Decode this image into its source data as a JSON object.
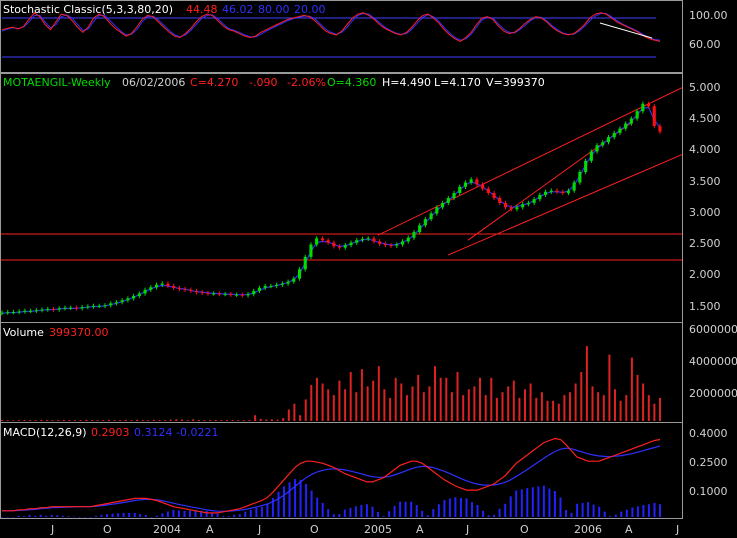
{
  "colors": {
    "background": "#000000",
    "axis_text": "#d0d0d0",
    "panel_border": "#9a9a9a",
    "candle_up": "#00dd00",
    "candle_down": "#ff1010",
    "trend_line": "#ff2020",
    "horizontal_line": "#ff2020",
    "ma_line": "#3030ff",
    "volume_bar": "#dd2222",
    "macd_line": "#ff2020",
    "signal_line": "#3030ff",
    "histogram": "#2222ff",
    "stoch_k": "#ff2020",
    "stoch_d": "#3030ff",
    "stoch_level": "#4040ff",
    "annotation_line": "#ffffff",
    "price_title": "#00dd00",
    "stoch_title": "#ffffff"
  },
  "stochastic": {
    "name": "Stochastic Classic(5,3,3,80,20)",
    "k_text": "44.48",
    "d_text": "46.02",
    "upper_text": "80.00",
    "lower_text": "20.00",
    "axis_ticks": [
      "100.00",
      "60.00"
    ]
  },
  "price": {
    "symbol": "MOTAENGIL-Weekly",
    "date": "06/02/2006",
    "close": "C=4.270",
    "change": "-.090",
    "change_pct": "-2.06%",
    "open": "O=4.360",
    "high": "H=4.490",
    "low": "L=4.170",
    "volume": "V=399370",
    "axis_ticks": [
      "5.000",
      "4.500",
      "4.000",
      "3.500",
      "3.000",
      "2.500",
      "2.000",
      "1.500"
    ]
  },
  "volume": {
    "label": "Volume",
    "value_text": "399370.00",
    "axis_ticks": [
      "6000000",
      "4000000",
      "2000000"
    ]
  },
  "macd": {
    "label": "MACD(12,26,9)",
    "macd_text": "0.2903",
    "signal_text": "0.3124",
    "hist_text": "-0.0221",
    "axis_ticks": [
      "0.4000",
      "0.2500",
      "0.1000"
    ]
  },
  "x_axis": {
    "labels": [
      "J",
      "O",
      "2004",
      "A",
      "J",
      "O",
      "2005",
      "A",
      "J",
      "O",
      "2006",
      "A",
      "J"
    ]
  },
  "chart_data": [
    {
      "type": "line",
      "title": "Stochastic Classic(5,3,3,80,20)",
      "ylim": [
        0,
        100
      ],
      "levels": [
        80,
        20
      ],
      "series": [
        {
          "values": [
            62,
            64,
            66,
            63,
            67,
            78,
            88,
            82,
            70,
            62,
            74,
            86,
            84,
            76,
            66,
            58,
            66,
            80,
            86,
            82,
            72,
            64,
            58,
            52,
            56,
            66,
            78,
            84,
            82,
            74,
            66,
            58,
            52,
            50,
            56,
            64,
            74,
            82,
            86,
            84,
            76,
            68,
            62,
            60,
            56,
            52,
            50,
            52,
            58,
            62,
            66,
            70,
            74,
            78,
            80,
            82,
            84,
            82,
            76,
            68,
            60,
            56,
            54,
            60,
            70,
            80,
            86,
            88,
            84,
            78,
            70,
            64,
            60,
            56,
            54,
            58,
            66,
            76,
            84,
            86,
            80,
            72,
            62,
            54,
            48,
            44,
            50,
            58,
            70,
            80,
            82,
            78,
            68,
            60,
            56,
            58,
            64,
            72,
            78,
            82,
            80,
            74,
            66,
            60,
            56,
            54,
            56,
            62,
            70,
            80,
            86,
            88,
            86,
            80,
            74,
            70,
            66,
            62,
            58,
            52,
            48,
            46,
            44
          ]
        },
        {
          "values": [
            60,
            63,
            65,
            64,
            66,
            74,
            84,
            84,
            74,
            65,
            70,
            82,
            85,
            80,
            70,
            61,
            63,
            75,
            84,
            84,
            76,
            68,
            60,
            54,
            55,
            62,
            74,
            82,
            83,
            77,
            69,
            61,
            54,
            51,
            54,
            61,
            70,
            79,
            84,
            85,
            79,
            71,
            64,
            61,
            58,
            54,
            51,
            51,
            55,
            60,
            64,
            68,
            72,
            76,
            79,
            81,
            83,
            83,
            79,
            71,
            63,
            58,
            55,
            58,
            66,
            76,
            84,
            87,
            86,
            80,
            73,
            66,
            61,
            57,
            55,
            56,
            63,
            72,
            81,
            85,
            82,
            75,
            65,
            57,
            50,
            46,
            48,
            55,
            66,
            77,
            81,
            80,
            71,
            63,
            58,
            57,
            62,
            69,
            76,
            81,
            81,
            76,
            68,
            62,
            57,
            55,
            55,
            60,
            67,
            76,
            83,
            87,
            87,
            82,
            76,
            71,
            67,
            63,
            59,
            54,
            50,
            47,
            46
          ]
        }
      ]
    },
    {
      "type": "candlestick",
      "title": "MOTAENGIL-Weekly",
      "ylim": [
        1.2,
        5.2
      ],
      "horizontal_lines": [
        2.62,
        2.2
      ],
      "close_values": [
        1.35,
        1.36,
        1.36,
        1.37,
        1.38,
        1.38,
        1.39,
        1.4,
        1.41,
        1.4,
        1.42,
        1.43,
        1.43,
        1.42,
        1.44,
        1.45,
        1.46,
        1.46,
        1.47,
        1.5,
        1.52,
        1.55,
        1.58,
        1.62,
        1.66,
        1.72,
        1.76,
        1.8,
        1.82,
        1.78,
        1.75,
        1.73,
        1.72,
        1.7,
        1.68,
        1.67,
        1.66,
        1.66,
        1.65,
        1.65,
        1.64,
        1.64,
        1.63,
        1.65,
        1.7,
        1.75,
        1.78,
        1.78,
        1.8,
        1.82,
        1.85,
        1.9,
        2.05,
        2.25,
        2.45,
        2.55,
        2.52,
        2.48,
        2.42,
        2.4,
        2.44,
        2.48,
        2.52,
        2.54,
        2.55,
        2.5,
        2.46,
        2.44,
        2.43,
        2.45,
        2.5,
        2.56,
        2.65,
        2.76,
        2.86,
        2.95,
        3.05,
        3.12,
        3.2,
        3.28,
        3.38,
        3.45,
        3.5,
        3.42,
        3.35,
        3.28,
        3.2,
        3.12,
        3.05,
        3.02,
        3.05,
        3.1,
        3.12,
        3.18,
        3.25,
        3.3,
        3.32,
        3.3,
        3.28,
        3.32,
        3.45,
        3.62,
        3.8,
        3.95,
        4.05,
        4.1,
        4.18,
        4.25,
        4.32,
        4.4,
        4.48,
        4.6,
        4.72,
        4.68,
        4.36,
        4.27
      ],
      "ma_values": [
        1.34,
        1.35,
        1.35,
        1.36,
        1.37,
        1.37,
        1.38,
        1.39,
        1.4,
        1.4,
        1.41,
        1.42,
        1.42,
        1.42,
        1.43,
        1.44,
        1.45,
        1.45,
        1.46,
        1.48,
        1.5,
        1.53,
        1.56,
        1.6,
        1.64,
        1.69,
        1.73,
        1.77,
        1.79,
        1.78,
        1.76,
        1.74,
        1.73,
        1.71,
        1.69,
        1.68,
        1.67,
        1.66,
        1.66,
        1.65,
        1.65,
        1.64,
        1.64,
        1.64,
        1.67,
        1.71,
        1.75,
        1.77,
        1.79,
        1.81,
        1.84,
        1.88,
        1.98,
        2.15,
        2.34,
        2.48,
        2.5,
        2.49,
        2.45,
        2.42,
        2.43,
        2.46,
        2.5,
        2.52,
        2.54,
        2.51,
        2.48,
        2.46,
        2.44,
        2.45,
        2.48,
        2.53,
        2.6,
        2.7,
        2.8,
        2.9,
        3.0,
        3.08,
        3.16,
        3.24,
        3.33,
        3.41,
        3.46,
        3.43,
        3.38,
        3.31,
        3.24,
        3.16,
        3.09,
        3.05,
        3.06,
        3.09,
        3.11,
        3.16,
        3.22,
        3.27,
        3.3,
        3.3,
        3.29,
        3.31,
        3.41,
        3.56,
        3.73,
        3.88,
        4.0,
        4.07,
        4.15,
        4.22,
        4.29,
        4.36,
        4.44,
        4.54,
        4.65,
        4.66,
        4.46,
        4.33
      ]
    },
    {
      "type": "bar",
      "title": "Volume",
      "ylim": [
        0,
        6800000
      ],
      "values": [
        60000,
        60000,
        50000,
        60000,
        60000,
        60000,
        60000,
        80000,
        60000,
        60000,
        60000,
        80000,
        60000,
        60000,
        60000,
        80000,
        60000,
        60000,
        60000,
        80000,
        60000,
        60000,
        80000,
        60000,
        80000,
        60000,
        60000,
        80000,
        60000,
        60000,
        100000,
        120000,
        100000,
        60000,
        120000,
        60000,
        60000,
        60000,
        80000,
        60000,
        60000,
        60000,
        60000,
        60000,
        60000,
        400000,
        150000,
        100000,
        120000,
        100000,
        200000,
        800000,
        1200000,
        400000,
        1500000,
        2500000,
        3000000,
        2600000,
        2200000,
        1800000,
        2800000,
        2200000,
        3400000,
        2000000,
        3600000,
        2400000,
        2800000,
        3800000,
        2200000,
        1600000,
        3000000,
        2600000,
        1800000,
        2400000,
        3200000,
        2000000,
        2400000,
        3800000,
        3000000,
        3000000,
        2000000,
        3400000,
        1800000,
        2200000,
        2400000,
        3000000,
        1800000,
        3000000,
        1600000,
        2000000,
        2400000,
        2800000,
        1600000,
        2200000,
        2600000,
        1600000,
        2000000,
        1400000,
        1400000,
        1200000,
        1800000,
        2000000,
        2600000,
        3400000,
        5200000,
        2400000,
        2000000,
        1800000,
        4600000,
        2200000,
        1400000,
        1800000,
        4400000,
        3200000,
        2600000,
        1800000,
        1200000,
        1600000
      ]
    },
    {
      "type": "line",
      "title": "MACD(12,26,9)",
      "ylim": [
        0.0,
        0.45
      ],
      "series": [
        {
          "values": [
            0.03,
            0.03,
            0.03,
            0.035,
            0.035,
            0.04,
            0.04,
            0.045,
            0.045,
            0.05,
            0.05,
            0.05,
            0.05,
            0.05,
            0.05,
            0.05,
            0.05,
            0.055,
            0.06,
            0.065,
            0.07,
            0.075,
            0.08,
            0.085,
            0.09,
            0.09,
            0.09,
            0.085,
            0.08,
            0.07,
            0.06,
            0.05,
            0.045,
            0.04,
            0.035,
            0.03,
            0.025,
            0.02,
            0.02,
            0.02,
            0.025,
            0.03,
            0.035,
            0.04,
            0.05,
            0.06,
            0.07,
            0.08,
            0.095,
            0.12,
            0.15,
            0.18,
            0.21,
            0.24,
            0.26,
            0.27,
            0.27,
            0.265,
            0.26,
            0.25,
            0.24,
            0.225,
            0.21,
            0.2,
            0.19,
            0.18,
            0.17,
            0.17,
            0.18,
            0.19,
            0.21,
            0.23,
            0.25,
            0.26,
            0.27,
            0.27,
            0.26,
            0.24,
            0.22,
            0.2,
            0.18,
            0.165,
            0.15,
            0.14,
            0.13,
            0.13,
            0.13,
            0.14,
            0.15,
            0.16,
            0.18,
            0.2,
            0.23,
            0.26,
            0.28,
            0.3,
            0.32,
            0.34,
            0.36,
            0.37,
            0.38,
            0.375,
            0.35,
            0.32,
            0.29,
            0.28,
            0.27,
            0.27,
            0.27,
            0.28,
            0.29,
            0.3,
            0.31,
            0.32,
            0.33,
            0.34,
            0.35,
            0.36,
            0.37,
            0.375
          ]
        },
        {
          "values": [
            0.03,
            0.03,
            0.03,
            0.032,
            0.033,
            0.035,
            0.037,
            0.04,
            0.042,
            0.045,
            0.046,
            0.047,
            0.048,
            0.049,
            0.05,
            0.05,
            0.05,
            0.052,
            0.055,
            0.058,
            0.062,
            0.066,
            0.07,
            0.075,
            0.08,
            0.083,
            0.085,
            0.085,
            0.083,
            0.079,
            0.073,
            0.067,
            0.061,
            0.055,
            0.05,
            0.045,
            0.04,
            0.035,
            0.031,
            0.028,
            0.027,
            0.028,
            0.03,
            0.033,
            0.037,
            0.042,
            0.048,
            0.055,
            0.063,
            0.074,
            0.089,
            0.106,
            0.126,
            0.148,
            0.17,
            0.19,
            0.206,
            0.218,
            0.226,
            0.231,
            0.233,
            0.232,
            0.228,
            0.222,
            0.216,
            0.209,
            0.201,
            0.195,
            0.192,
            0.192,
            0.196,
            0.203,
            0.213,
            0.223,
            0.233,
            0.241,
            0.245,
            0.244,
            0.239,
            0.231,
            0.221,
            0.21,
            0.198,
            0.186,
            0.175,
            0.166,
            0.159,
            0.155,
            0.154,
            0.155,
            0.16,
            0.168,
            0.18,
            0.196,
            0.213,
            0.23,
            0.248,
            0.266,
            0.284,
            0.301,
            0.317,
            0.328,
            0.333,
            0.33,
            0.322,
            0.314,
            0.306,
            0.3,
            0.295,
            0.293,
            0.292,
            0.294,
            0.297,
            0.302,
            0.307,
            0.314,
            0.321,
            0.329,
            0.336,
            0.344
          ]
        }
      ]
    }
  ]
}
